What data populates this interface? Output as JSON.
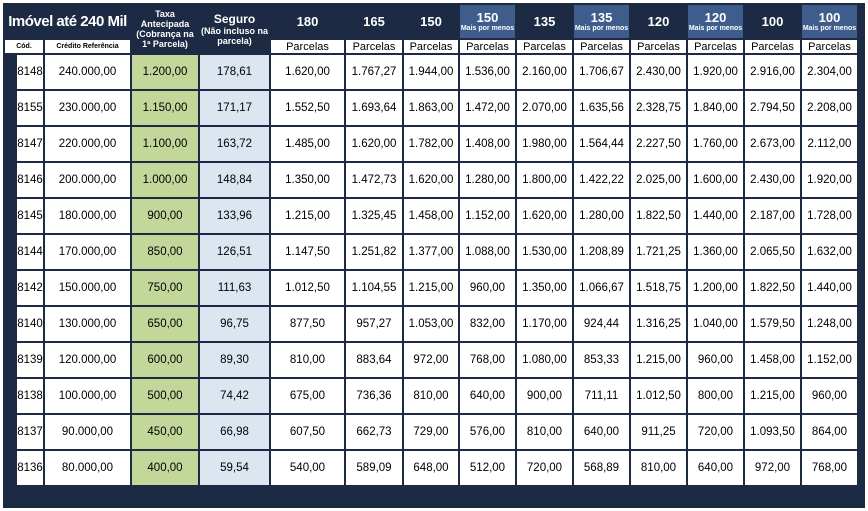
{
  "header": {
    "title": "Imóvel até 240 Mil",
    "taxa_label": "Taxa Antecipada (Cobrança na 1ª Parcela)",
    "seguro_label": "Seguro",
    "seguro_note": "(Não incluso na parcela)",
    "terms": [
      {
        "months": "180",
        "note": "",
        "highlight": false
      },
      {
        "months": "165",
        "note": "",
        "highlight": false
      },
      {
        "months": "150",
        "note": "",
        "highlight": false
      },
      {
        "months": "150",
        "note": "Mais por menos",
        "highlight": true
      },
      {
        "months": "135",
        "note": "",
        "highlight": false
      },
      {
        "months": "135",
        "note": "Mais por menos",
        "highlight": true
      },
      {
        "months": "120",
        "note": "",
        "highlight": false
      },
      {
        "months": "120",
        "note": "Mais por menos",
        "highlight": true
      },
      {
        "months": "100",
        "note": "",
        "highlight": false
      },
      {
        "months": "100",
        "note": "Mais por menos",
        "highlight": true
      }
    ]
  },
  "subheader": {
    "cod": "Cód.",
    "credito": "Crédito Referência",
    "parcelas": "Parcelas"
  },
  "rows": [
    {
      "cod": "8148",
      "credito": "240.000,00",
      "taxa": "1.200,00",
      "seguro": "178,61",
      "values": [
        "1.620,00",
        "1.767,27",
        "1.944,00",
        "1.536,00",
        "2.160,00",
        "1.706,67",
        "2.430,00",
        "1.920,00",
        "2.916,00",
        "2.304,00"
      ]
    },
    {
      "cod": "8155",
      "credito": "230.000,00",
      "taxa": "1.150,00",
      "seguro": "171,17",
      "values": [
        "1.552,50",
        "1.693,64",
        "1.863,00",
        "1.472,00",
        "2.070,00",
        "1.635,56",
        "2.328,75",
        "1.840,00",
        "2.794,50",
        "2.208,00"
      ]
    },
    {
      "cod": "8147",
      "credito": "220.000,00",
      "taxa": "1.100,00",
      "seguro": "163,72",
      "values": [
        "1.485,00",
        "1.620,00",
        "1.782,00",
        "1.408,00",
        "1.980,00",
        "1.564,44",
        "2.227,50",
        "1.760,00",
        "2.673,00",
        "2.112,00"
      ]
    },
    {
      "cod": "8146",
      "credito": "200.000,00",
      "taxa": "1.000,00",
      "seguro": "148,84",
      "values": [
        "1.350,00",
        "1.472,73",
        "1.620,00",
        "1.280,00",
        "1.800,00",
        "1.422,22",
        "2.025,00",
        "1.600,00",
        "2.430,00",
        "1.920,00"
      ]
    },
    {
      "cod": "8145",
      "credito": "180.000,00",
      "taxa": "900,00",
      "seguro": "133,96",
      "values": [
        "1.215,00",
        "1.325,45",
        "1.458,00",
        "1.152,00",
        "1.620,00",
        "1.280,00",
        "1.822,50",
        "1.440,00",
        "2.187,00",
        "1.728,00"
      ]
    },
    {
      "cod": "8144",
      "credito": "170.000,00",
      "taxa": "850,00",
      "seguro": "126,51",
      "values": [
        "1.147,50",
        "1.251,82",
        "1.377,00",
        "1.088,00",
        "1.530,00",
        "1.208,89",
        "1.721,25",
        "1.360,00",
        "2.065,50",
        "1.632,00"
      ]
    },
    {
      "cod": "8142",
      "credito": "150.000,00",
      "taxa": "750,00",
      "seguro": "111,63",
      "values": [
        "1.012,50",
        "1.104,55",
        "1.215,00",
        "960,00",
        "1.350,00",
        "1.066,67",
        "1.518,75",
        "1.200,00",
        "1.822,50",
        "1.440,00"
      ]
    },
    {
      "cod": "8140",
      "credito": "130.000,00",
      "taxa": "650,00",
      "seguro": "96,75",
      "values": [
        "877,50",
        "957,27",
        "1.053,00",
        "832,00",
        "1.170,00",
        "924,44",
        "1.316,25",
        "1.040,00",
        "1.579,50",
        "1.248,00"
      ]
    },
    {
      "cod": "8139",
      "credito": "120.000,00",
      "taxa": "600,00",
      "seguro": "89,30",
      "values": [
        "810,00",
        "883,64",
        "972,00",
        "768,00",
        "1.080,00",
        "853,33",
        "1.215,00",
        "960,00",
        "1.458,00",
        "1.152,00"
      ]
    },
    {
      "cod": "8138",
      "credito": "100.000,00",
      "taxa": "500,00",
      "seguro": "74,42",
      "values": [
        "675,00",
        "736,36",
        "810,00",
        "640,00",
        "900,00",
        "711,11",
        "1.012,50",
        "800,00",
        "1.215,00",
        "960,00"
      ]
    },
    {
      "cod": "8137",
      "credito": "90.000,00",
      "taxa": "450,00",
      "seguro": "66,98",
      "values": [
        "607,50",
        "662,73",
        "729,00",
        "576,00",
        "810,00",
        "640,00",
        "911,25",
        "720,00",
        "1.093,50",
        "864,00"
      ]
    },
    {
      "cod": "8136",
      "credito": "80.000,00",
      "taxa": "400,00",
      "seguro": "59,54",
      "values": [
        "540,00",
        "589,09",
        "648,00",
        "512,00",
        "720,00",
        "568,89",
        "810,00",
        "640,00",
        "972,00",
        "768,00"
      ]
    }
  ],
  "colors": {
    "header_dark": "#1c2a44",
    "header_highlight": "#3f5d8c",
    "taxa_fill": "#c4d79b",
    "seguro_fill": "#dce6f1"
  }
}
